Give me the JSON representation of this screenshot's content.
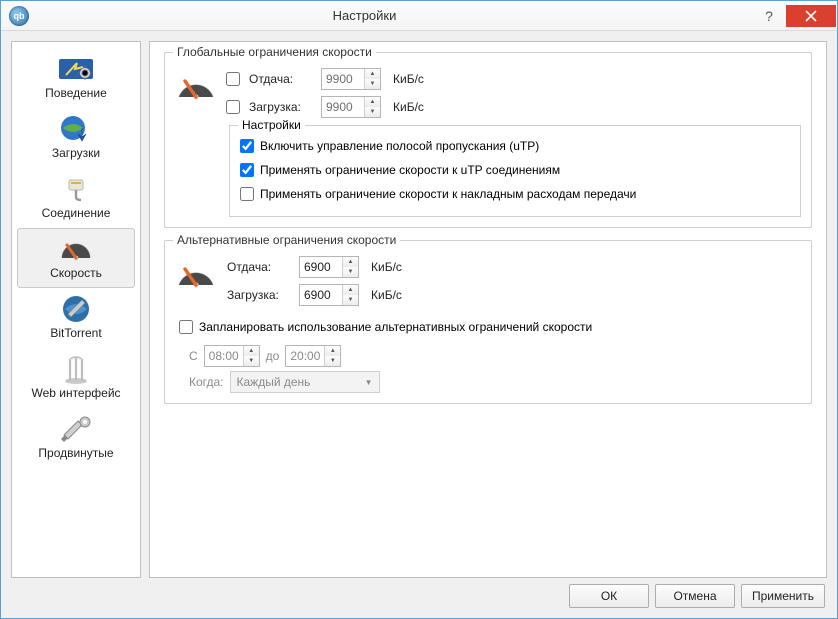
{
  "window": {
    "title": "Настройки"
  },
  "sidebar": [
    {
      "key": "behavior",
      "label": "Поведение"
    },
    {
      "key": "downloads",
      "label": "Загрузки"
    },
    {
      "key": "connection",
      "label": "Соединение"
    },
    {
      "key": "speed",
      "label": "Скорость",
      "selected": true
    },
    {
      "key": "bittorrent",
      "label": "BitTorrent"
    },
    {
      "key": "webui",
      "label": "Web интерфейс"
    },
    {
      "key": "advanced",
      "label": "Продвинутые"
    }
  ],
  "global": {
    "legend": "Глобальные ограничения скорости",
    "upload_label": "Отдача:",
    "download_label": "Загрузка:",
    "upload_value": "9900",
    "download_value": "9900",
    "upload_enabled": false,
    "download_enabled": false,
    "unit": "КиБ/с",
    "options_legend": "Настройки",
    "opt_utp": {
      "label": "Включить управление полосой пропускания (uTP)",
      "checked": true
    },
    "opt_utp_limit": {
      "label": "Применять ограничение скорости к uTP соединениям",
      "checked": true
    },
    "opt_overhead": {
      "label": "Применять ограничение скорости к накладным расходам передачи",
      "checked": false
    }
  },
  "alt": {
    "legend": "Альтернативные ограничения скорости",
    "upload_label": "Отдача:",
    "download_label": "Загрузка:",
    "upload_value": "6900",
    "download_value": "6900",
    "unit": "КиБ/с",
    "schedule_label": "Запланировать использование альтернативных ограничений скорости",
    "schedule_checked": false,
    "from_label": "С",
    "to_label": "до",
    "from_value": "08:00",
    "to_value": "20:00",
    "when_label": "Когда:",
    "when_value": "Каждый день"
  },
  "buttons": {
    "ok": "ОК",
    "cancel": "Отмена",
    "apply": "Применить"
  }
}
